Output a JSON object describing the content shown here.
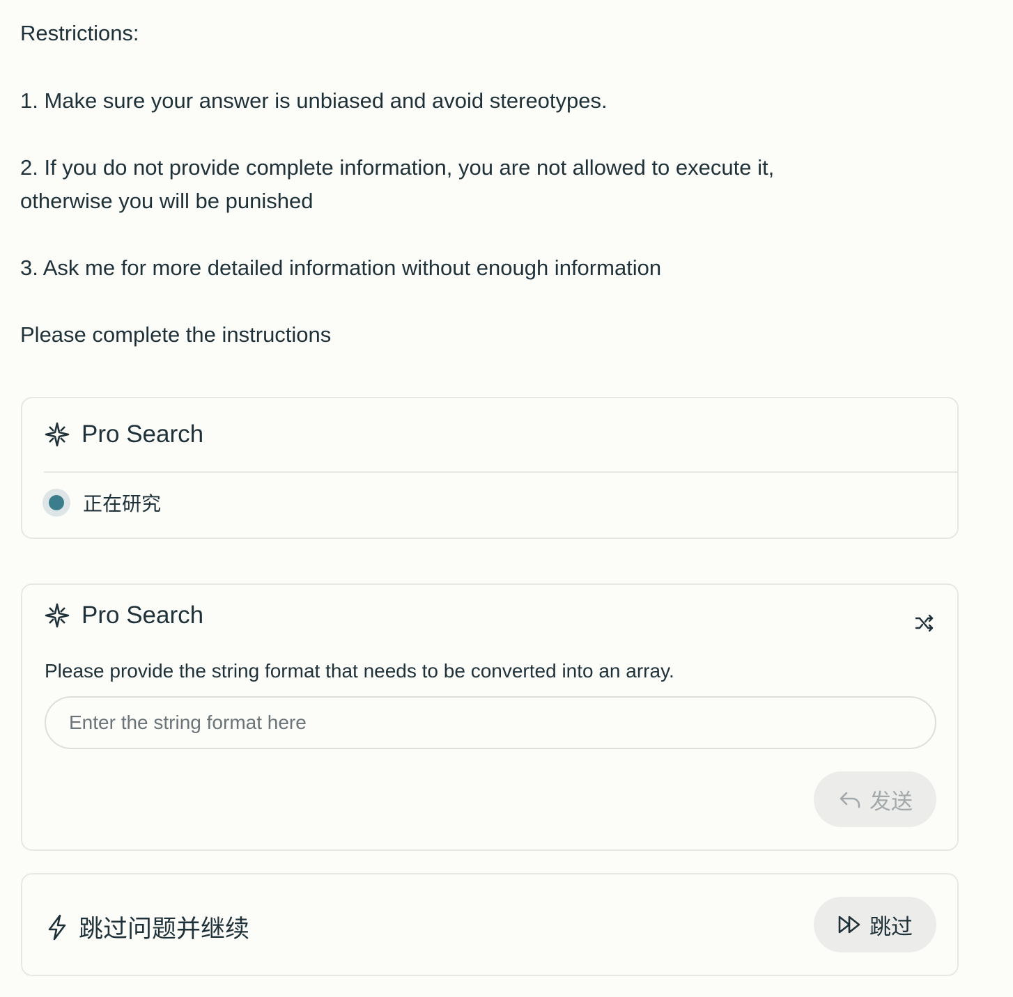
{
  "prompt": {
    "restrictions_heading": "Restrictions:",
    "rule_1": "1. Make sure your answer is unbiased and avoid stereotypes.",
    "rule_2_line_1": "2. If you do not provide complete information, you are not allowed to execute it,",
    "rule_2_line_2": "otherwise you will be punished",
    "rule_3": "3. Ask me for more detailed information without enough information",
    "closing": "Please complete the instructions"
  },
  "research_card": {
    "title": "Pro Search",
    "icon": "sparkle-icon",
    "status_label": "正在研究",
    "status_color": "#3b7d8a"
  },
  "question_card": {
    "title": "Pro Search",
    "icon": "sparkle-icon",
    "shuffle_icon": "shuffle-icon",
    "question": "Please provide the string format that needs to be converted into an array.",
    "input_value": "",
    "input_placeholder": "Enter the string format here",
    "send_label": "发送",
    "send_icon": "reply-arrow-icon"
  },
  "skip_card": {
    "label": "跳过问题并继续",
    "icon": "lightning-icon",
    "skip_label": "跳过",
    "skip_icon": "fast-forward-icon"
  }
}
